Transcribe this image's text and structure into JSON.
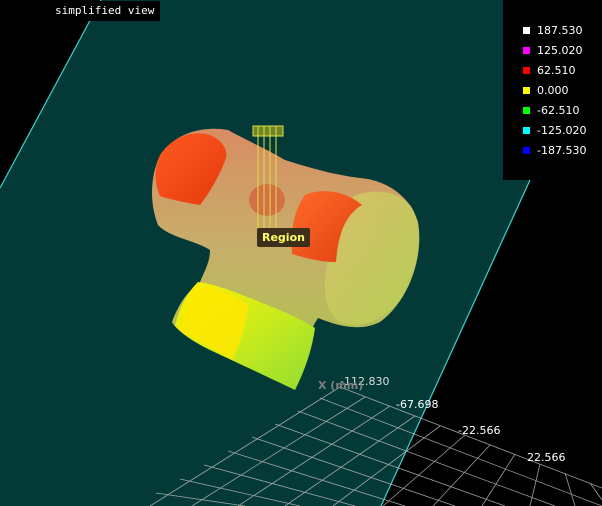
{
  "view_mode_label": "simplified view",
  "region_label": "Region",
  "legend": {
    "entries": [
      {
        "value": "187.530",
        "color": "#ffffff"
      },
      {
        "value": "125.020",
        "color": "#ff00ff"
      },
      {
        "value": "62.510",
        "color": "#ff0000"
      },
      {
        "value": "0.000",
        "color": "#ffff00"
      },
      {
        "value": "-62.510",
        "color": "#00ff00"
      },
      {
        "value": "-125.020",
        "color": "#00ffff"
      },
      {
        "value": "-187.530",
        "color": "#0000ff"
      }
    ]
  },
  "axis": {
    "title": "X (mm)",
    "ticks": [
      "-112.830",
      "-67.698",
      "-22.566",
      "22.566"
    ]
  },
  "colors": {
    "ground_plane": "#033a38",
    "ground_edge": "#39d3d3",
    "grid_lines": "#b9b9b9",
    "background": "#000000"
  },
  "icons": {
    "region_marker": "probe-marker-icon"
  }
}
